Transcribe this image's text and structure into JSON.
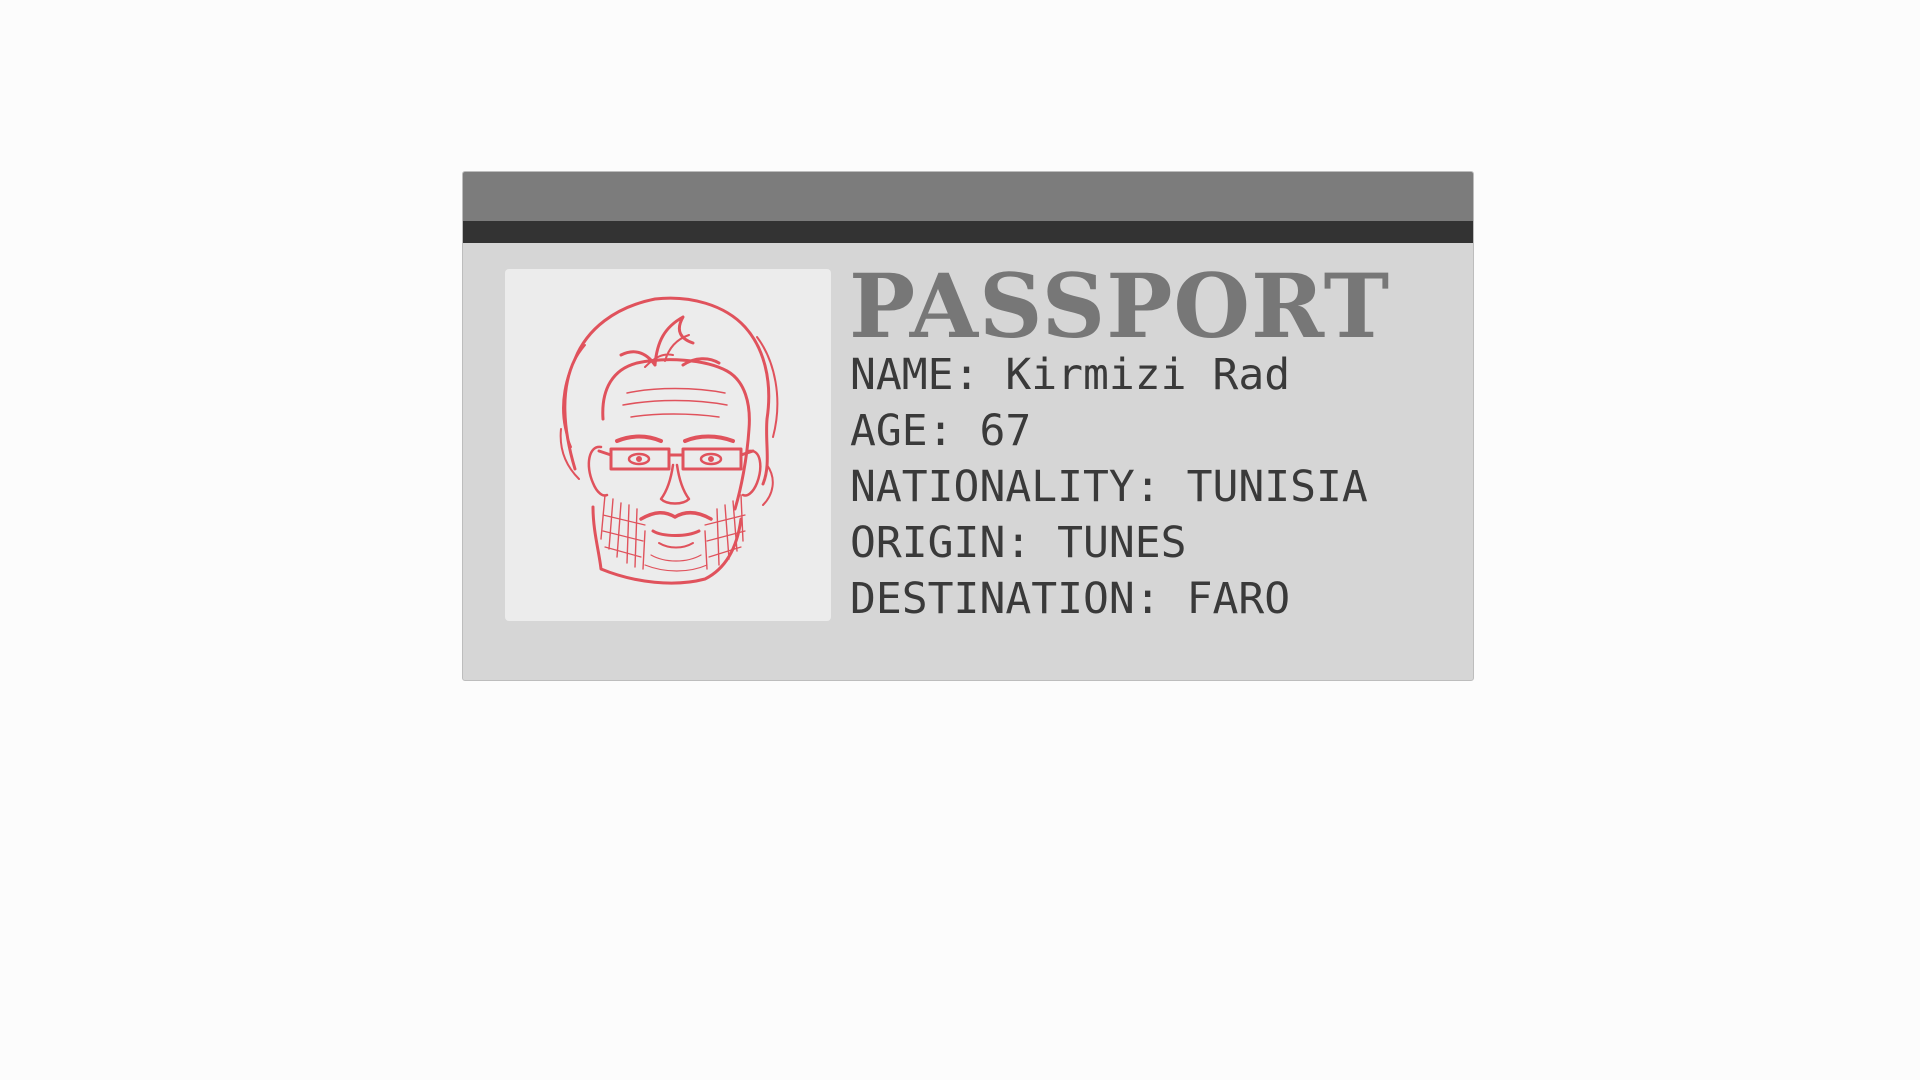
{
  "document": {
    "title": "PASSPORT",
    "photo_icon": "portrait-sketch-icon",
    "fields": [
      {
        "label": "NAME",
        "value": "Kirmizi Rad"
      },
      {
        "label": "AGE",
        "value": "67"
      },
      {
        "label": "NATIONALITY",
        "value": "TUNISIA"
      },
      {
        "label": "ORIGIN",
        "value": "TUNES"
      },
      {
        "label": "DESTINATION",
        "value": "FARO"
      }
    ]
  },
  "colors": {
    "page_background": "#fcfcfc",
    "card_background": "#d6d6d6",
    "top_band": "#7c7c7c",
    "dark_band": "#333333",
    "photo_background": "#ececec",
    "title_text": "#777777",
    "field_text": "#3a3a3a",
    "sketch_ink": "#e0525c"
  }
}
